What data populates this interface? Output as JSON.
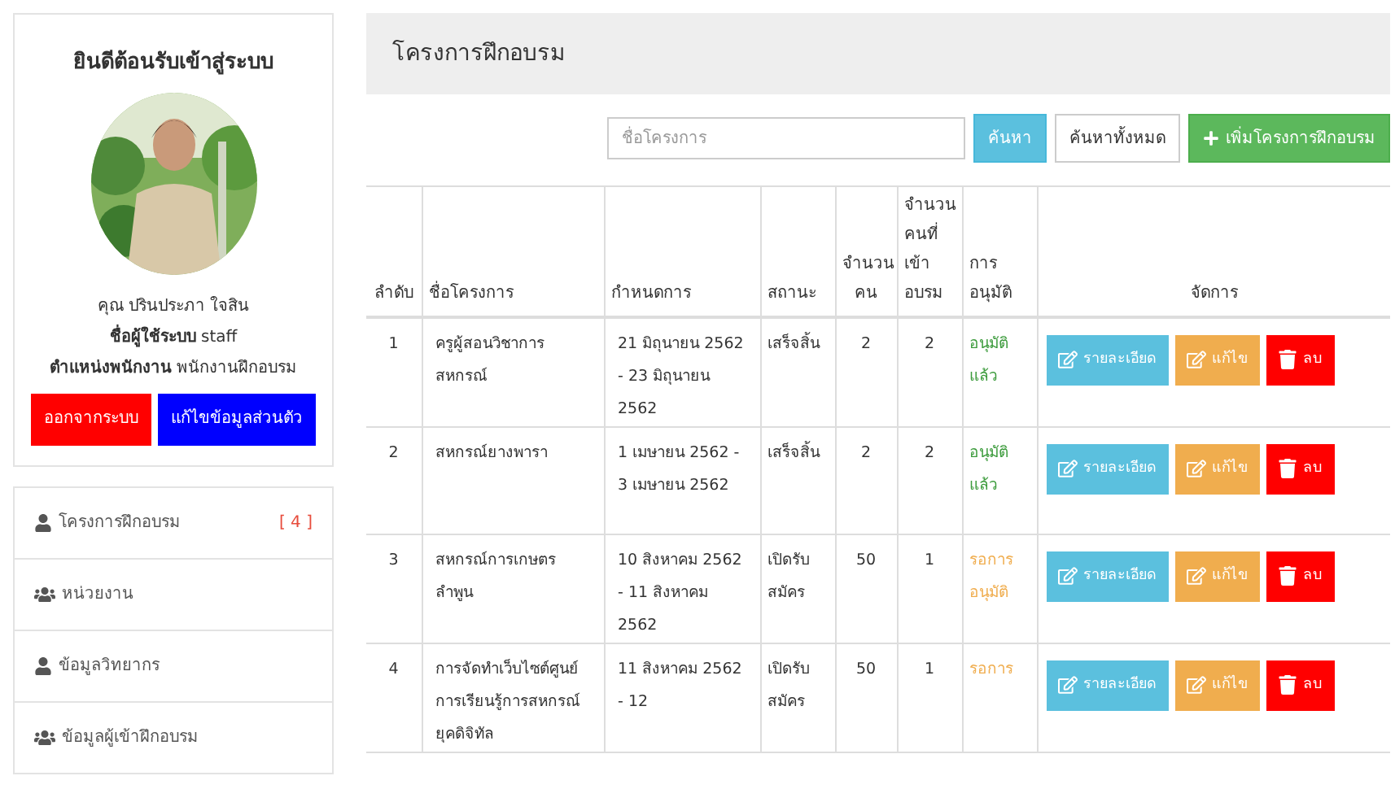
{
  "profile": {
    "title": "ยินดีต้อนรับเข้าสู่ระบบ",
    "name": "คุณ ปรินประภา ใจสิน",
    "username": "**ชื่อผู้ใช้ระบบ** staff",
    "position": "**ตำแหน่งพนักงาน** พนักงานฝึกอบรม",
    "buttons": [
      {
        "label": "ออกจากระบบ",
        "kind": "danger"
      },
      {
        "label": "แก้ไขข้อมูลส่วนตัว",
        "kind": "primary"
      }
    ]
  },
  "menu": [
    {
      "label": "โครงการฝึกอบรม",
      "kind": "single",
      "count": "[ 4 ]"
    },
    {
      "label": "หน่วยงาน",
      "kind": "group"
    },
    {
      "label": "ข้อมูลวิทยากร",
      "kind": "single"
    },
    {
      "label": "ข้อมูลผู้เข้าฝึกอบรม",
      "kind": "group"
    }
  ],
  "page_title": "โครงการฝึกอบรม",
  "search": {
    "placeholder": "ชื่อโครงการ",
    "buttons": [
      {
        "label": "ค้นหา",
        "kind": "info"
      },
      {
        "label": "ค้นหาทั้งหมด",
        "kind": "default"
      },
      {
        "label": "เพิ่มโครงการฝึกอบรม",
        "kind": "success"
      }
    ]
  },
  "table": {
    "columns": [
      "ลำดับ",
      "ชื่อโครงการ",
      "กำหนดการ",
      "สถานะ",
      "จำนวนคน",
      "จำนวนคนที่เข้าอบรม",
      "การอนุมัติ",
      "จัดการ"
    ],
    "rows": [
      {
        "no": "1",
        "name": "ครูผู้สอนวิชาการสหกรณ์",
        "schedule": "21 มิถุนายน 2562 - 23 มิถุนายน 2562",
        "status": "เสร็จสิ้น",
        "capacity": "2",
        "attended": "2",
        "approval": {
          "text": "อนุมัติแล้ว",
          "kind": "approved"
        },
        "actions": [
          {
            "label": "รายละเอียด",
            "kind": "detail"
          },
          {
            "label": "แก้ไข",
            "kind": "edit"
          },
          {
            "label": "ลบ",
            "kind": "delete"
          }
        ]
      },
      {
        "no": "2",
        "name": "สหกรณ์ยางพารา",
        "schedule": "1 เมษายน 2562 - 3 เมษายน 2562",
        "status": "เสร็จสิ้น",
        "capacity": "2",
        "attended": "2",
        "approval": {
          "text": "อนุมัติแล้ว",
          "kind": "approved"
        },
        "actions": [
          {
            "label": "รายละเอียด",
            "kind": "detail"
          },
          {
            "label": "แก้ไข",
            "kind": "edit"
          },
          {
            "label": "ลบ",
            "kind": "delete"
          }
        ]
      },
      {
        "no": "3",
        "name": "สหกรณ์การเกษตรลำพูน",
        "schedule": "10 สิงหาคม 2562 - 11 สิงหาคม 2562",
        "status": "เปิดรับสมัคร",
        "capacity": "50",
        "attended": "1",
        "approval": {
          "text": "รอการอนุมัติ",
          "kind": "pending"
        },
        "actions": [
          {
            "label": "รายละเอียด",
            "kind": "detail"
          },
          {
            "label": "แก้ไข",
            "kind": "edit"
          },
          {
            "label": "ลบ",
            "kind": "delete"
          }
        ]
      },
      {
        "no": "4",
        "name": "การจัดทำเว็บไซต์ศูนย์การเรียนรู้การสหกรณ์ยุคดิจิทัล",
        "schedule": "11 สิงหาคม 2562 - 12",
        "status": "เปิดรับสมัคร",
        "capacity": "50",
        "attended": "1",
        "approval": {
          "text": "รอการ",
          "kind": "pending"
        },
        "actions": [
          {
            "label": "รายละเอียด",
            "kind": "detail"
          },
          {
            "label": "แก้ไข",
            "kind": "edit"
          },
          {
            "label": "ลบ",
            "kind": "delete"
          }
        ]
      }
    ]
  }
}
